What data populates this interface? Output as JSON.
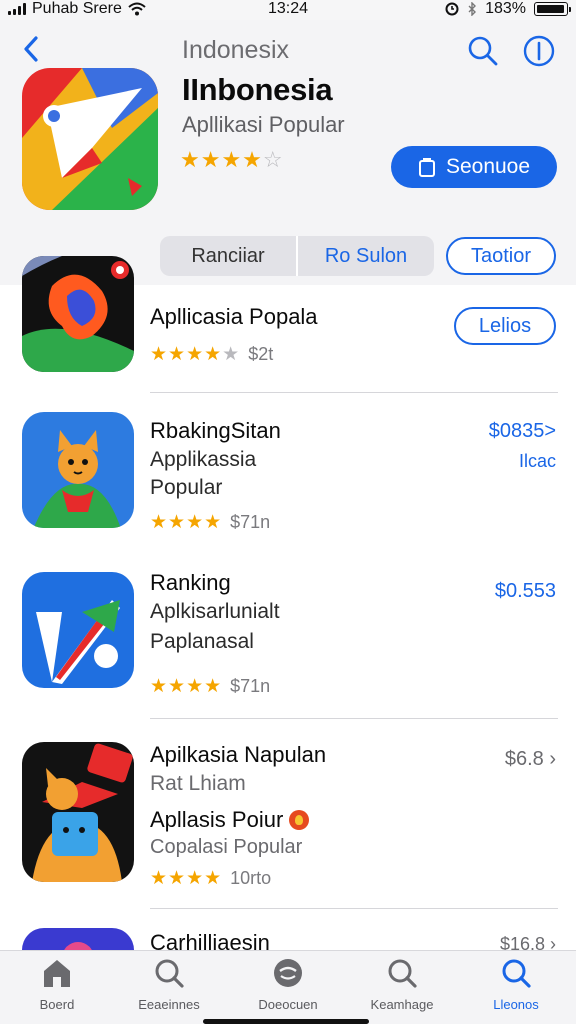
{
  "status_bar": {
    "carrier": "Puhab Srere",
    "time": "13:24",
    "battery": "183%"
  },
  "header": {
    "nav_title": "Indonesix"
  },
  "hero": {
    "title": "IInbonesia",
    "subtitle": "Apllikasi Popular",
    "stars": "★★★★☆",
    "get_label": "Seonuoe"
  },
  "segments": [
    "Ranciiar",
    "Ro Sulon"
  ],
  "toggle_button": "Taotior",
  "apps": [
    {
      "name": "Apllicasia Popala",
      "stars": "★★★★★",
      "meta": "$2t",
      "button": "Lelios"
    },
    {
      "name": "RbakingSitan",
      "line2": "Applikassia",
      "line3": "Popular",
      "stars": "★★★★",
      "meta": "$71n",
      "price": "$0835>",
      "sub_action": "Ilcac"
    },
    {
      "name": "Ranking",
      "line2": "Aplkisarlunialt",
      "line3": "Paplanasal",
      "stars": "★★★★",
      "meta": "$71n",
      "price": "$0.553"
    },
    {
      "name": "Apilkasia Napulan",
      "line2": "Rat Lhiam",
      "line3": "Apllasis Poiur",
      "line4": "Copalasi Popular",
      "stars": "★★★★",
      "meta": "10rto",
      "price": "$6.8 ›"
    },
    {
      "name": "Carhilliaesin",
      "price": "$16.8 ›"
    }
  ],
  "tabbar": [
    {
      "label": "Boerd",
      "icon": "home-icon"
    },
    {
      "label": "Eeaeinnes",
      "icon": "search-icon"
    },
    {
      "label": "Doeocuen",
      "icon": "emoji-icon"
    },
    {
      "label": "Keamhage",
      "icon": "search-icon"
    },
    {
      "label": "Lleonos",
      "icon": "search-icon"
    }
  ],
  "colors": {
    "accent": "#1a66e6",
    "star": "#f5a500",
    "header_bg": "#f4f4f6"
  }
}
